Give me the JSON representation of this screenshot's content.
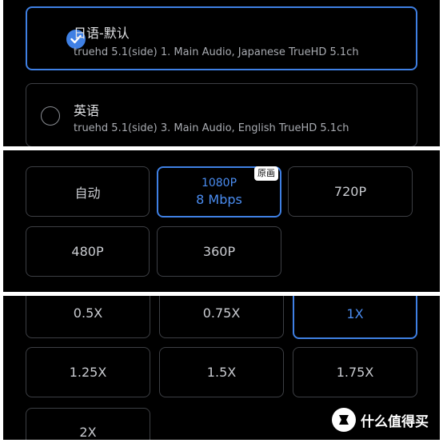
{
  "audio": {
    "tracks": [
      {
        "title": "日语-默认",
        "desc": "truehd 5.1(side) 1. Main Audio, Japanese TrueHD 5.1ch",
        "selected": true
      },
      {
        "title": "英语",
        "desc": "truehd 5.1(side) 3. Main Audio, English TrueHD 5.1ch",
        "selected": false
      }
    ]
  },
  "quality": {
    "options": [
      {
        "label": "自动"
      },
      {
        "label": "1080P",
        "sub": "8 Mbps",
        "badge": "原画",
        "selected": true
      },
      {
        "label": "720P"
      },
      {
        "label": "480P"
      },
      {
        "label": "360P"
      }
    ]
  },
  "speed": {
    "options": [
      {
        "label": "0.5X"
      },
      {
        "label": "0.75X"
      },
      {
        "label": "1X",
        "selected": true
      },
      {
        "label": "1.25X"
      },
      {
        "label": "1.5X"
      },
      {
        "label": "1.75X"
      },
      {
        "label": "2X"
      }
    ]
  },
  "watermark": {
    "text": "什么值得买",
    "icon": "smzdm-logo-icon"
  },
  "colors": {
    "accent": "#3f80e4",
    "background": "#000000",
    "border": "#3d3f44"
  }
}
